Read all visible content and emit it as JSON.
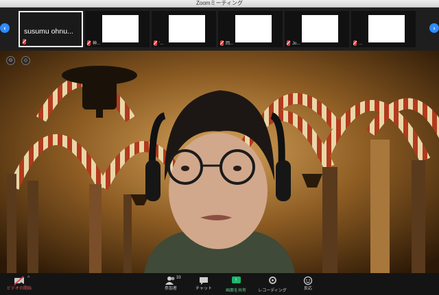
{
  "window": {
    "title": "Zoomミーティング"
  },
  "gallery": {
    "prev_label": "‹",
    "next_label": "›",
    "tiles": [
      {
        "name": "susumu ohnu...",
        "label": ""
      },
      {
        "name": "",
        "label": "神..."
      },
      {
        "name": "",
        "label": "'..."
      },
      {
        "name": "",
        "label": "岡..."
      },
      {
        "name": "",
        "label": "Jo..."
      },
      {
        "name": "",
        "label": "..."
      }
    ]
  },
  "toolbar": {
    "video_label": "ビデオの開始",
    "participants_label": "参加者",
    "participants_count": "33",
    "chat_label": "チャット",
    "share_label": "画面を共有",
    "record_label": "レコーディング",
    "reactions_label": "反応"
  },
  "colors": {
    "accent": "#2d8cff",
    "share": "#18b86a",
    "muted": "#e23b3b"
  }
}
